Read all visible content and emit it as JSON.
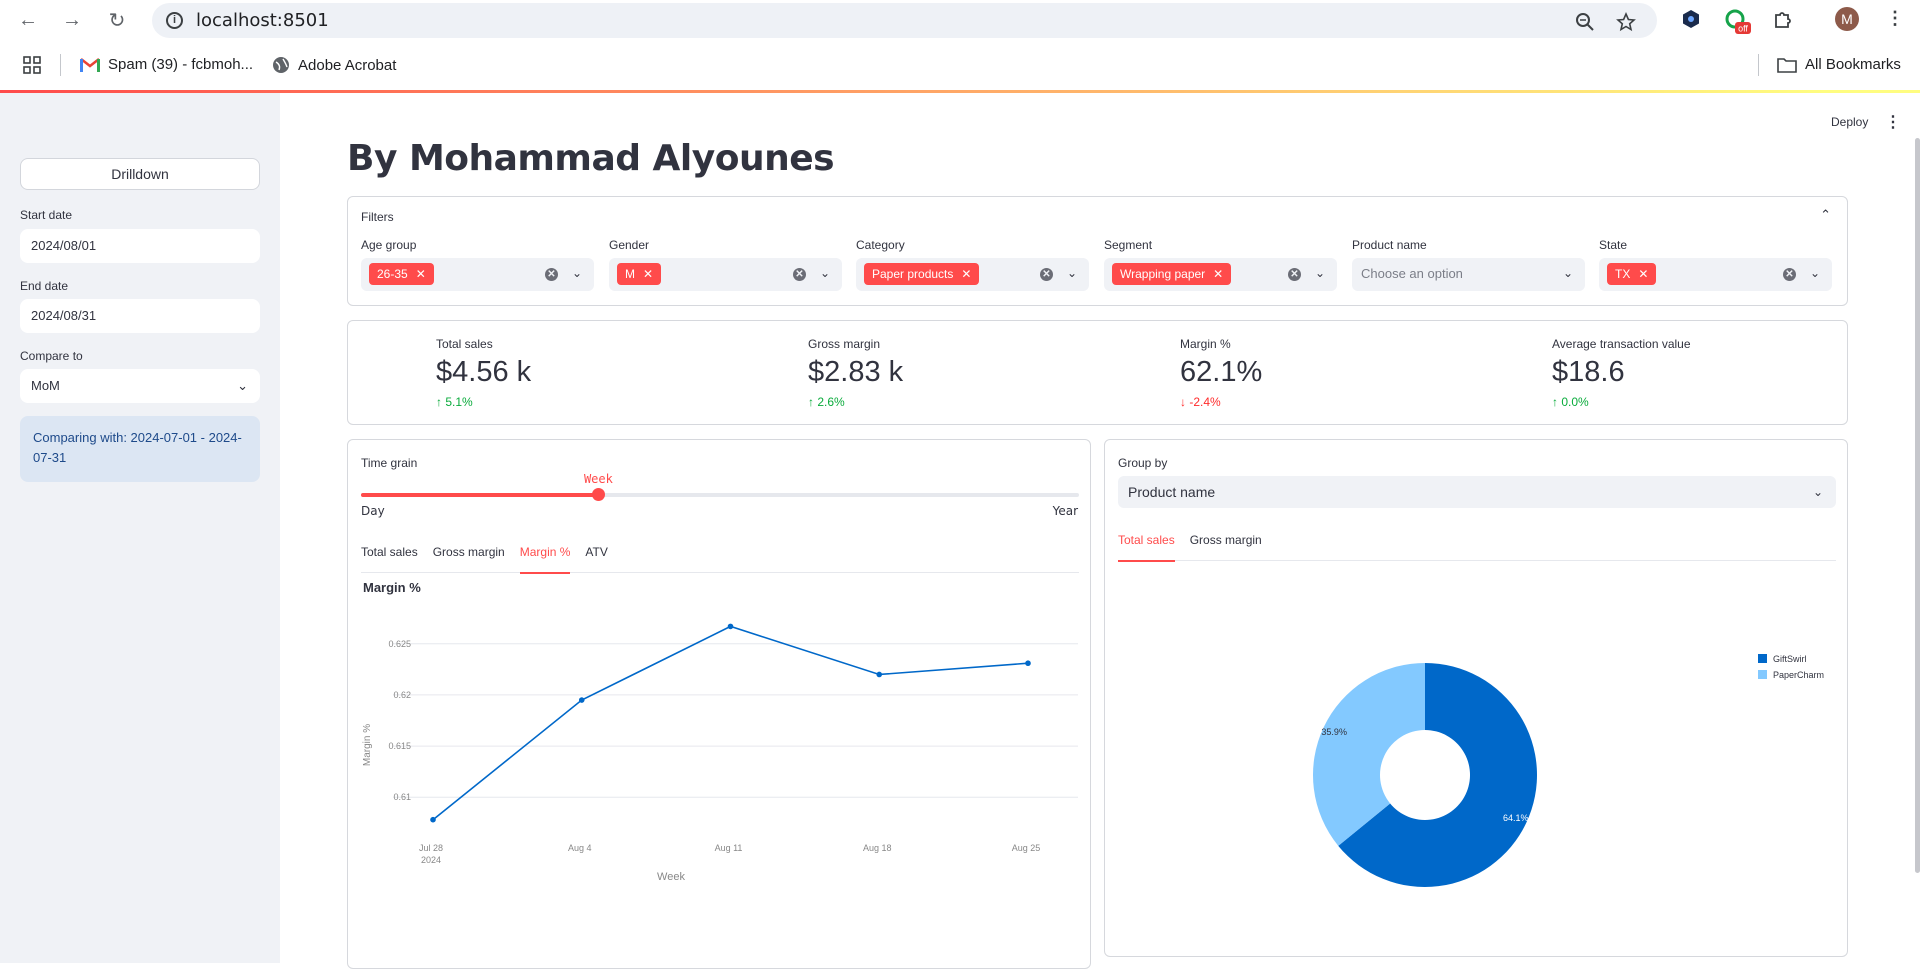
{
  "browser": {
    "url": "localhost:8501",
    "bookmarks": [
      {
        "label": "Spam (39) - fcbmoh..."
      },
      {
        "label": "Adobe Acrobat"
      }
    ],
    "all_bookmarks": "All Bookmarks",
    "profile_initial": "M",
    "extension_badge": "off"
  },
  "sidebar": {
    "drilldown_button": "Drilldown",
    "start_date_label": "Start date",
    "start_date_value": "2024/08/01",
    "end_date_label": "End date",
    "end_date_value": "2024/08/31",
    "compare_label": "Compare to",
    "compare_value": "MoM",
    "info_text": "Comparing with: 2024-07-01 - 2024-07-31"
  },
  "header": {
    "deploy": "Deploy",
    "title": "By Mohammad Alyounes"
  },
  "filters": {
    "title": "Filters",
    "items": [
      {
        "label": "Age group",
        "chip": "26-35"
      },
      {
        "label": "Gender",
        "chip": "M"
      },
      {
        "label": "Category",
        "chip": "Paper products"
      },
      {
        "label": "Segment",
        "chip": "Wrapping paper"
      },
      {
        "label": "Product name",
        "placeholder": "Choose an option"
      },
      {
        "label": "State",
        "chip": "TX"
      }
    ]
  },
  "metrics": [
    {
      "label": "Total sales",
      "value": "$4.56 k",
      "delta": "5.1%",
      "direction": "up"
    },
    {
      "label": "Gross margin",
      "value": "$2.83 k",
      "delta": "2.6%",
      "direction": "up"
    },
    {
      "label": "Margin %",
      "value": "62.1%",
      "delta": "-2.4%",
      "direction": "down"
    },
    {
      "label": "Average transaction value",
      "value": "$18.6",
      "delta": "0.0%",
      "direction": "up"
    }
  ],
  "time_panel": {
    "slider_label": "Time grain",
    "slider_value": "Week",
    "slider_min": "Day",
    "slider_max": "Year",
    "slider_fraction": 0.33,
    "tabs": [
      "Total sales",
      "Gross margin",
      "Margin %",
      "ATV"
    ],
    "active_tab": "Margin %"
  },
  "group_panel": {
    "label": "Group by",
    "value": "Product name",
    "tabs": [
      "Total sales",
      "Gross margin"
    ],
    "active_tab": "Total sales"
  },
  "colors": {
    "accent": "#ff4b4b",
    "line": "#0068c9",
    "pie_dark": "#0068c9",
    "pie_light": "#83c9ff",
    "up": "#09ab3b",
    "down": "#ff2b2b"
  },
  "chart_data": [
    {
      "type": "line",
      "title": "Margin %",
      "xlabel": "Week",
      "ylabel": "Margin %",
      "x": [
        "Jul 28",
        "Aug 4",
        "Aug 11",
        "Aug 18",
        "Aug 25"
      ],
      "x_sublabel": "2024",
      "values": [
        0.6078,
        0.6195,
        0.6267,
        0.622,
        0.6231
      ],
      "yticks": [
        0.61,
        0.615,
        0.62,
        0.625
      ],
      "ylim": [
        0.6065,
        0.6285
      ],
      "grid": true
    },
    {
      "type": "pie",
      "categories": [
        "GiftSwirl",
        "PaperCharm"
      ],
      "values": [
        64.1,
        35.9
      ],
      "labels": [
        "64.1%",
        "35.9%"
      ],
      "legend": "right",
      "donut": true
    }
  ]
}
